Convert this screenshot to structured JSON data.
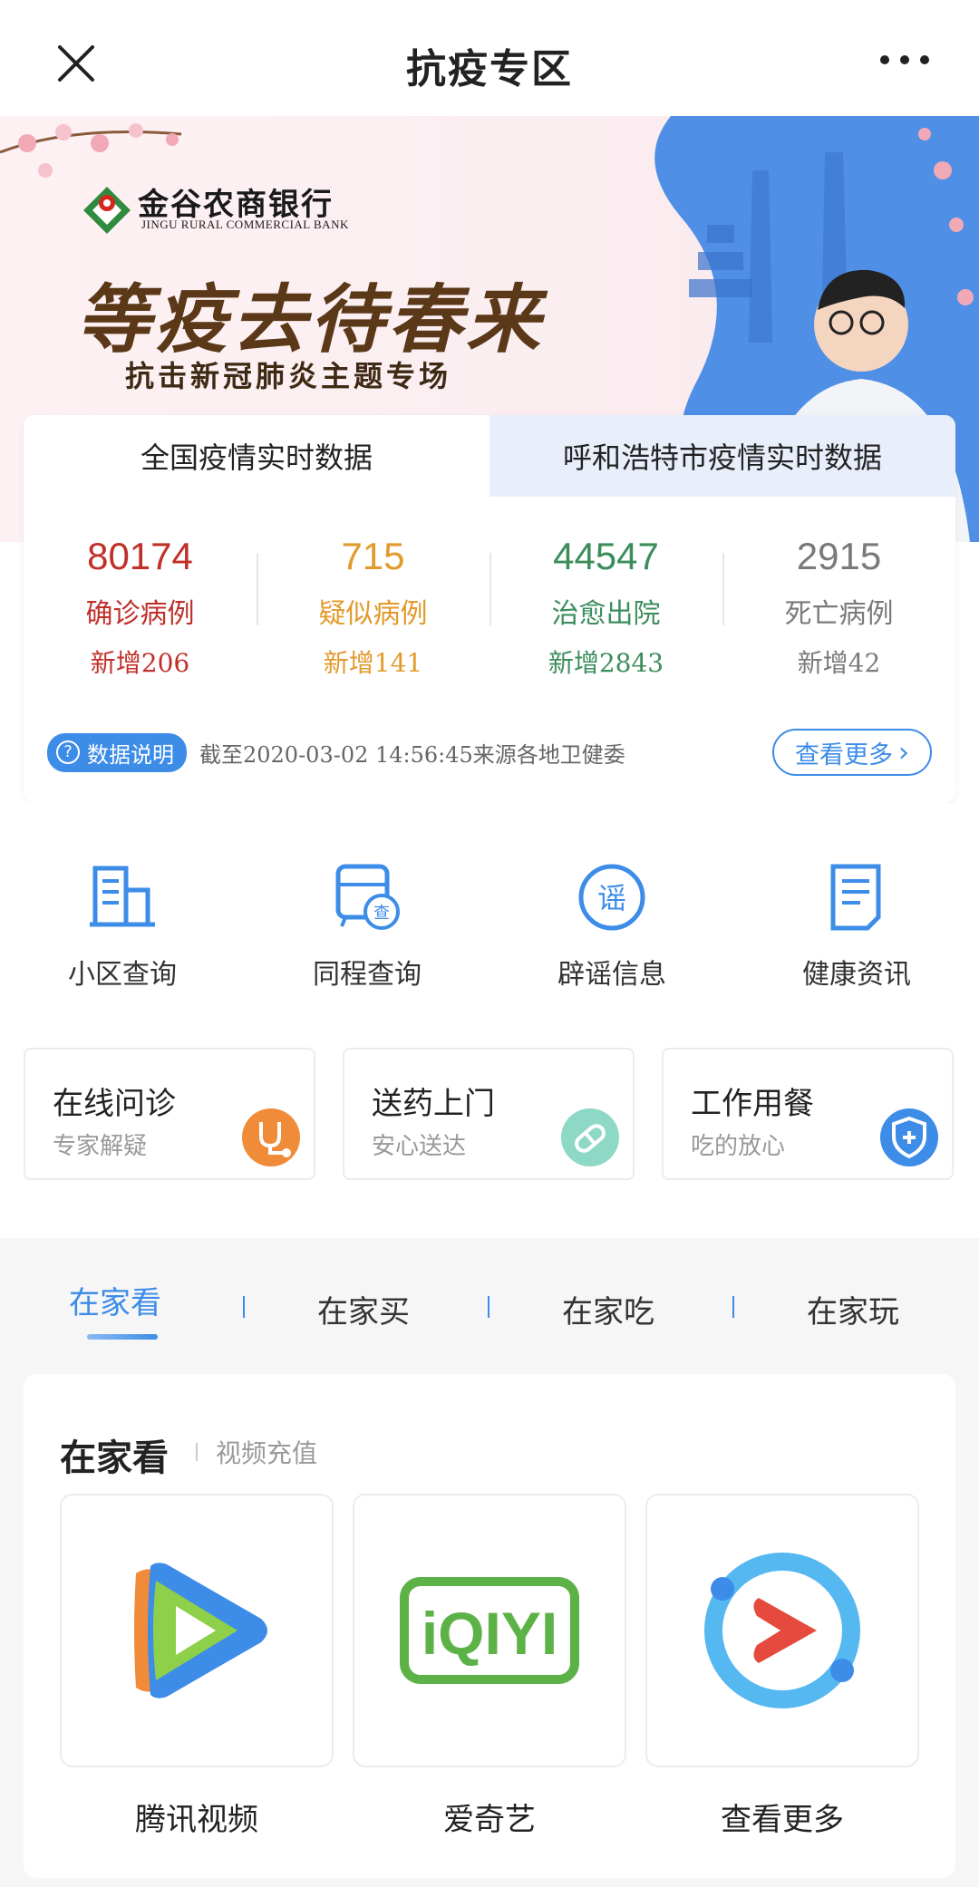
{
  "header": {
    "title": "抗疫专区",
    "close_icon": "close-icon",
    "more_icon": "more-dots-icon"
  },
  "banner": {
    "bank_name": "金谷农商银行",
    "bank_name_en": "JINGU RURAL COMMERCIAL BANK",
    "slogan": "等疫去待春来",
    "subslogan": "抗击新冠肺炎主题专场"
  },
  "data_tabs": [
    {
      "label": "全国疫情实时数据",
      "active": true
    },
    {
      "label": "呼和浩特市疫情实时数据",
      "active": false
    }
  ],
  "stats": [
    {
      "value": "80174",
      "label": "确诊病例",
      "increase": "新增206",
      "color": "#c0302a"
    },
    {
      "value": "715",
      "label": "疑似病例",
      "increase": "新增141",
      "color": "#e29a2c"
    },
    {
      "value": "44547",
      "label": "治愈出院",
      "increase": "新增2843",
      "color": "#3c8d5c"
    },
    {
      "value": "2915",
      "label": "死亡病例",
      "increase": "新增42",
      "color": "#7a7a7a"
    }
  ],
  "data_note": {
    "badge": "数据说明",
    "badge_icon": "?",
    "source": "截至2020-03-02 14:56:45来源各地卫健委",
    "more_button": "查看更多",
    "more_arrow": "›"
  },
  "quick_actions": [
    {
      "label": "小区查询",
      "icon": "building-icon"
    },
    {
      "label": "同程查询",
      "icon": "train-search-icon",
      "icon_text": "查"
    },
    {
      "label": "辟谣信息",
      "icon": "rumor-icon",
      "icon_text": "谣"
    },
    {
      "label": "健康资讯",
      "icon": "document-icon"
    }
  ],
  "services": [
    {
      "title": "在线问诊",
      "desc": "专家解疑",
      "icon": "stethoscope-icon",
      "color": "#f08b3a"
    },
    {
      "title": "送药上门",
      "desc": "安心送达",
      "icon": "pill-icon",
      "color": "#8ed8c6"
    },
    {
      "title": "工作用餐",
      "desc": "吃的放心",
      "icon": "shield-icon",
      "color": "#3d8ce8"
    }
  ],
  "home_tabs": [
    {
      "label": "在家看",
      "active": true
    },
    {
      "label": "在家买",
      "active": false
    },
    {
      "label": "在家吃",
      "active": false
    },
    {
      "label": "在家玩",
      "active": false
    }
  ],
  "home_section": {
    "title": "在家看",
    "subtitle": "视频充值",
    "items": [
      {
        "name": "腾讯视频",
        "icon": "tencent-video-icon"
      },
      {
        "name": "爱奇艺",
        "icon": "iqiyi-icon",
        "logo_text": "iQIYI"
      },
      {
        "name": "查看更多",
        "icon": "play-more-icon"
      }
    ]
  },
  "colors": {
    "accent": "#3d8ce8",
    "tab_inactive_bg": "#e9eefb"
  }
}
